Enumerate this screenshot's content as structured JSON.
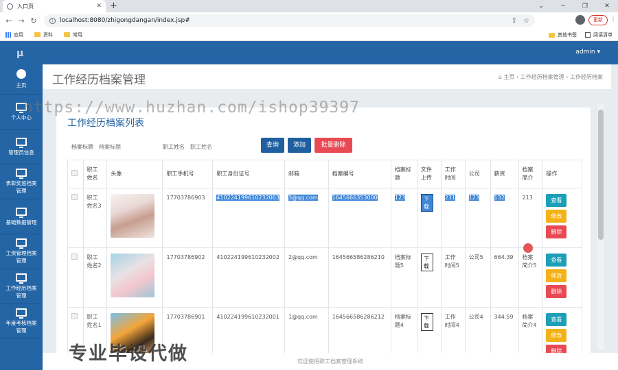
{
  "browser": {
    "tab_title": "入口页",
    "url": "localhost:8080/zhigongdangan/index.jsp#",
    "update_label": "更新",
    "bookmarks": [
      "应用",
      "资料",
      "常用"
    ],
    "bookmarks_right": [
      "其他书签",
      "阅读清单"
    ]
  },
  "header": {
    "logo": "μ",
    "user": "admin ▾"
  },
  "sidebar": {
    "items": [
      {
        "label": "主页",
        "icon": "dashboard-icon"
      },
      {
        "label": "个人中心",
        "icon": "monitor-icon"
      },
      {
        "label": "管理员信息",
        "icon": "monitor-icon"
      },
      {
        "label": "表彰奖惩档案管理",
        "icon": "monitor-icon"
      },
      {
        "label": "基础数据管理",
        "icon": "monitor-icon"
      },
      {
        "label": "工资管理档案管理",
        "icon": "monitor-icon"
      },
      {
        "label": "工作经历档案管理",
        "icon": "monitor-icon"
      },
      {
        "label": "年度考核档案管理",
        "icon": "monitor-icon"
      }
    ]
  },
  "page": {
    "title": "工作经历档案管理",
    "breadcrumb": [
      "⌂ 主页",
      "›",
      "工作经历档案管理",
      "›",
      "工作经历档案"
    ],
    "watermark_url": "https://www.huzhan.com/ishop39397",
    "watermark_bottom": "专业毕设代做"
  },
  "panel": {
    "heading": "工作经历档案列表",
    "search": {
      "field1_label": "档案标题",
      "field1_placeholder": "档案标题",
      "field2_label": "职工姓名",
      "field2_placeholder": "职工姓名"
    },
    "buttons": {
      "query": "查询",
      "add": "添加",
      "batch_delete": "批量删除"
    }
  },
  "table": {
    "columns": [
      "职工姓名",
      "头像",
      "职工手机号",
      "职工身份证号",
      "邮箱",
      "档案编号",
      "档案标题",
      "文件上传",
      "工作时间",
      "公司",
      "薪资",
      "档案简介",
      "操作"
    ],
    "rows": [
      {
        "name": "职工姓名3",
        "phone": "17703786903",
        "idcard": "410224199610232003",
        "email": "3@qq.com",
        "archive_no": "1645666353000",
        "title": "123",
        "file": "下载",
        "work_time": "231",
        "company": "123",
        "salary": "132",
        "intro": "213"
      },
      {
        "name": "职工姓名2",
        "phone": "17703786902",
        "idcard": "410224199610232002",
        "email": "2@qq.com",
        "archive_no": "164566586286210",
        "title": "档案标题5",
        "file": "下载",
        "work_time": "工作时间5",
        "company": "公司5",
        "salary": "664.39",
        "intro": "档案简介5"
      },
      {
        "name": "职工姓名1",
        "phone": "17703786901",
        "idcard": "410224199610232001",
        "email": "1@qq.com",
        "archive_no": "164566586286212",
        "title": "档案标题4",
        "file": "下载",
        "work_time": "工作时间4",
        "company": "公司4",
        "salary": "344.59",
        "intro": "档案简介4"
      }
    ],
    "actions": {
      "view": "查看",
      "edit": "修改",
      "delete": "删除"
    }
  },
  "footer": "欢迎使用职工档案管理系统"
}
